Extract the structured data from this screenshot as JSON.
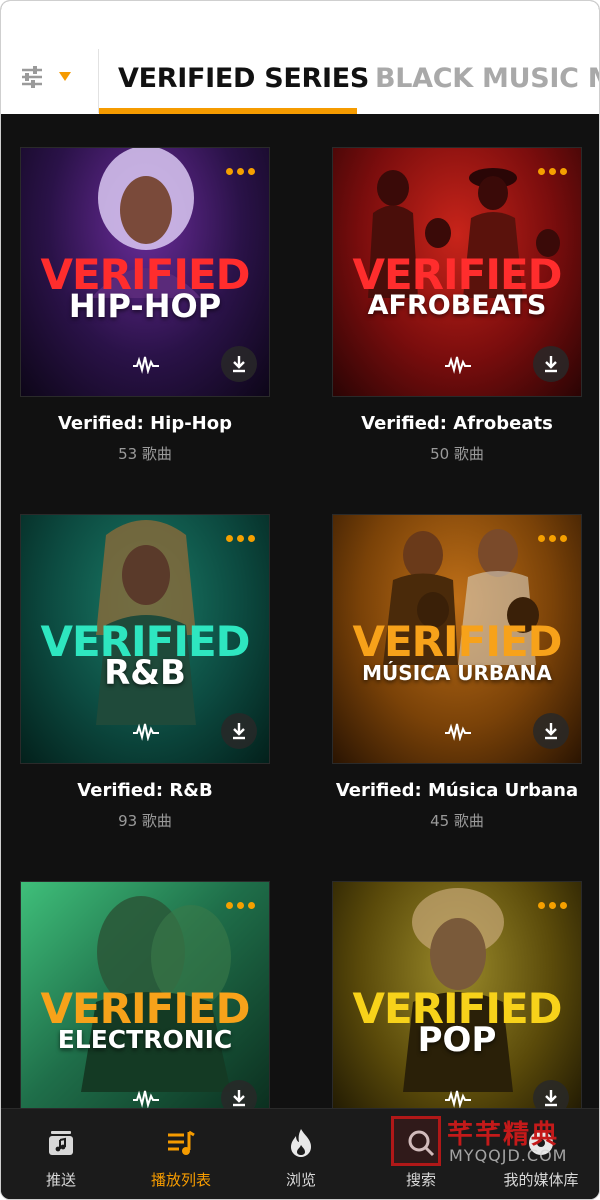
{
  "tabs": [
    {
      "label": "VERIFIED SERIES",
      "active": true
    },
    {
      "label": "BLACK MUSIC M",
      "active": false
    }
  ],
  "accent_color": "#f59b00",
  "filter": {
    "icon": "sliders-icon",
    "caret_icon": "caret-down-icon"
  },
  "playlists": [
    {
      "cover_word": "VERIFIED",
      "cover_genre": "HIP-HOP",
      "title": "Verified: Hip-Hop",
      "count": "53 歌曲",
      "word_color": "#ff2d2d",
      "bg": "#2a1248"
    },
    {
      "cover_word": "VERIFIED",
      "cover_genre": "AFROBEATS",
      "title": "Verified: Afrobeats",
      "count": "50 歌曲",
      "word_color": "#ff2d2d",
      "bg": "#7a0d0d"
    },
    {
      "cover_word": "VERIFIED",
      "cover_genre": "R&B",
      "title": "Verified: R&B",
      "count": "93 歌曲",
      "word_color": "#2ee6c0",
      "bg": "#0c4a40"
    },
    {
      "cover_word": "VERIFIED",
      "cover_genre": "MÚSICA URBANA",
      "title": "Verified: Música Urbana",
      "count": "45 歌曲",
      "word_color": "#f7a21a",
      "bg": "#7a4208"
    },
    {
      "cover_word": "VERIFIED",
      "cover_genre": "ELECTRONIC",
      "title": "",
      "count": "",
      "word_color": "#f7a21a",
      "bg": "#1f6f4a"
    },
    {
      "cover_word": "VERIFIED",
      "cover_genre": "POP",
      "title": "",
      "count": "",
      "word_color": "#f7d21a",
      "bg": "#5a4a0a"
    }
  ],
  "bottom_nav": [
    {
      "label": "推送",
      "icon": "feed-icon",
      "active": false
    },
    {
      "label": "播放列表",
      "icon": "playlist-icon",
      "active": true
    },
    {
      "label": "浏览",
      "icon": "flame-icon",
      "active": false
    },
    {
      "label": "搜索",
      "icon": "search-icon",
      "active": false
    },
    {
      "label": "我的媒体库",
      "icon": "library-icon",
      "active": false
    }
  ],
  "watermark": {
    "cn": "芊芊精典",
    "en": "MYQQJD.COM"
  }
}
